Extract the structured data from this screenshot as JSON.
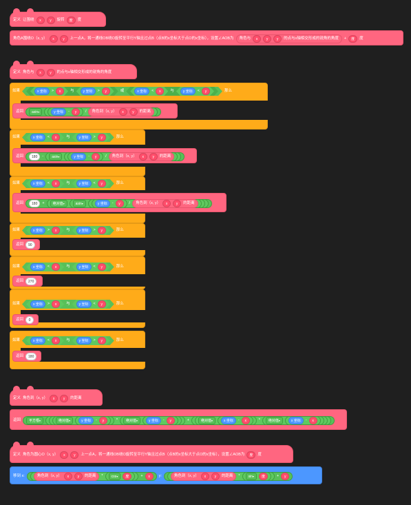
{
  "common": {
    "define": "定义",
    "ret": "返回",
    "if": "如果",
    "then": "那么",
    "and": "与",
    "or": "或",
    "x": "x",
    "y": "y",
    "deg": "度",
    "xpos": "x 坐标",
    "ypos": "y 坐标",
    "lt": "<",
    "gt": ">",
    "minus": "-",
    "plus": "+",
    "times": "*",
    "div": "/",
    "asin": "asin",
    "abs": "绝对值",
    "sqrt": "平方根",
    "cos": "cos",
    "sin": "sin",
    "n90": "90",
    "n270": "270",
    "n0": "0",
    "n180": "180"
  },
  "block1": {
    "title": "让围绕",
    "rot": "旋转",
    "desc": "角色A围绕O（x, y）",
    "desc2": "上一点A，将一通线OB绕O旋转至平行Y轴且过点B（点B的x坐标大于点O的x坐标），设置∠AOB为",
    "dir_call": "角色与",
    "dir_call2": "的点与x轴相交形成的锐角的角度"
  },
  "block2": {
    "title": "角色与",
    "title2": "的点与x轴相交形成的锐角的角度",
    "dist1": "角色到（x, y）",
    "dist2": "的距离"
  },
  "block3": {
    "title": "角色到（x, y）",
    "title2": "的距离"
  },
  "block4": {
    "title": "角色为圆心O（x, y）",
    "title2": "上一点A，将一通线OB绕O旋转至平行Y轴且过点B（点B的x坐标大于点O的x坐标），设置∠AOB为",
    "goto": "移到 x:",
    "goto_y": "y:"
  },
  "colors": {
    "bg": "#1f1f1f",
    "myblocks": "#ff6680",
    "control": "#ffab19",
    "operators": "#59c059",
    "motion": "#4c97ff"
  }
}
